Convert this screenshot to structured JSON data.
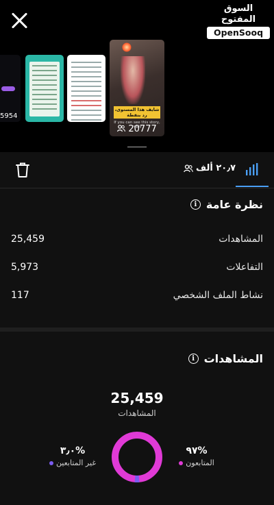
{
  "brand": {
    "name_ar": "السوق المفتوح",
    "name_en": "OpenSooq"
  },
  "stories": {
    "first_count": "5954",
    "main_caption_ar": "شايف هذا المستوى، رد بنقطة",
    "main_small": "If you can see this story, reply",
    "main_viewers": "20777"
  },
  "tabs": {
    "viewers_label": "٢٠٫٧ ألف"
  },
  "overview": {
    "title": "نظرة عامة",
    "rows": [
      {
        "label": "المشاهدات",
        "value": "25,459"
      },
      {
        "label": "التفاعلات",
        "value": "5,973"
      },
      {
        "label": "نشاط الملف الشخصي",
        "value": "117"
      }
    ]
  },
  "views": {
    "title": "المشاهدات",
    "total": "25,459",
    "total_label": "المشاهدات",
    "followers": {
      "pct": "%٩٧",
      "label": "المتابعون",
      "color": "#e03ad6",
      "value": 97
    },
    "non_followers": {
      "pct": "%٣٫٠",
      "label": "غير المتابعين",
      "color": "#7b5cf0",
      "value": 3
    }
  }
}
